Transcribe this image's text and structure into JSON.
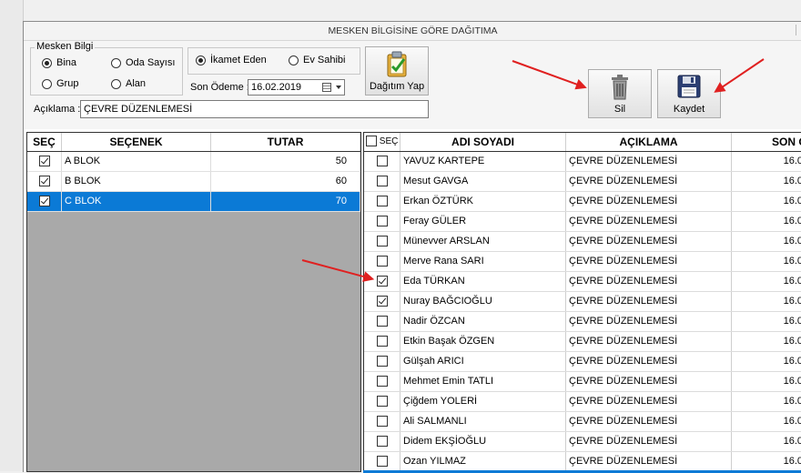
{
  "window": {
    "title": "MESKEN BİLGİSİNE GÖRE DAĞITIMA"
  },
  "mesken_bilgi": {
    "legend": "Mesken Bilgi",
    "options": [
      {
        "label": "Bina",
        "checked": true
      },
      {
        "label": "Oda Sayısı",
        "checked": false
      },
      {
        "label": "Grup",
        "checked": false
      },
      {
        "label": "Alan",
        "checked": false
      }
    ]
  },
  "owner": {
    "options": [
      {
        "label": "İkamet Eden",
        "checked": true
      },
      {
        "label": "Ev Sahibi",
        "checked": false
      }
    ]
  },
  "son_odeme": {
    "label": "Son Ödeme :",
    "value": "16.02.2019"
  },
  "aciklama": {
    "label": "Açıklama :",
    "value": "ÇEVRE DÜZENLEMESİ"
  },
  "buttons": {
    "dagitim": "Dağıtım Yap",
    "sil": "Sil",
    "kaydet": "Kaydet"
  },
  "left_grid": {
    "headers": [
      "SEÇ",
      "SEÇENEK",
      "TUTAR"
    ],
    "rows": [
      {
        "checked": true,
        "secenek": "A BLOK",
        "tutar": "50",
        "selected": false
      },
      {
        "checked": true,
        "secenek": "B BLOK",
        "tutar": "60",
        "selected": false
      },
      {
        "checked": true,
        "secenek": "C BLOK",
        "tutar": "70",
        "selected": true
      }
    ]
  },
  "right_grid": {
    "headers": {
      "sec": "SEÇ",
      "ad": "ADI SOYADI",
      "aciklama": "AÇIKLAMA",
      "son": "SON Ö"
    },
    "rows": [
      {
        "checked": false,
        "ad": "YAVUZ KARTEPE",
        "aciklama": "ÇEVRE DÜZENLEMESİ",
        "son": "16.0"
      },
      {
        "checked": false,
        "ad": "Mesut GAVGA",
        "aciklama": "ÇEVRE DÜZENLEMESİ",
        "son": "16.0"
      },
      {
        "checked": false,
        "ad": "Erkan ÖZTÜRK",
        "aciklama": "ÇEVRE DÜZENLEMESİ",
        "son": "16.0"
      },
      {
        "checked": false,
        "ad": "Feray GÜLER",
        "aciklama": "ÇEVRE DÜZENLEMESİ",
        "son": "16.0"
      },
      {
        "checked": false,
        "ad": "Münevver ARSLAN",
        "aciklama": "ÇEVRE DÜZENLEMESİ",
        "son": "16.0"
      },
      {
        "checked": false,
        "ad": "Merve Rana SARI",
        "aciklama": "ÇEVRE DÜZENLEMESİ",
        "son": "16.0"
      },
      {
        "checked": true,
        "ad": "Eda TÜRKAN",
        "aciklama": "ÇEVRE DÜZENLEMESİ",
        "son": "16.0"
      },
      {
        "checked": true,
        "ad": "Nuray BAĞCIOĞLU",
        "aciklama": "ÇEVRE DÜZENLEMESİ",
        "son": "16.0"
      },
      {
        "checked": false,
        "ad": "Nadir ÖZCAN",
        "aciklama": "ÇEVRE DÜZENLEMESİ",
        "son": "16.0"
      },
      {
        "checked": false,
        "ad": "Etkin Başak ÖZGEN",
        "aciklama": "ÇEVRE DÜZENLEMESİ",
        "son": "16.0"
      },
      {
        "checked": false,
        "ad": "Gülşah ARICI",
        "aciklama": "ÇEVRE DÜZENLEMESİ",
        "son": "16.0"
      },
      {
        "checked": false,
        "ad": "Mehmet Emin TATLI",
        "aciklama": "ÇEVRE DÜZENLEMESİ",
        "son": "16.0"
      },
      {
        "checked": false,
        "ad": "Çiğdem YOLERİ",
        "aciklama": "ÇEVRE DÜZENLEMESİ",
        "son": "16.0"
      },
      {
        "checked": false,
        "ad": "Ali SALMANLI",
        "aciklama": "ÇEVRE DÜZENLEMESİ",
        "son": "16.0"
      },
      {
        "checked": false,
        "ad": "Didem EKŞİOĞLU",
        "aciklama": "ÇEVRE DÜZENLEMESİ",
        "son": "16.0"
      },
      {
        "checked": false,
        "ad": "Ozan YILMAZ",
        "aciklama": "ÇEVRE DÜZENLEMESİ",
        "son": "16.0"
      }
    ]
  },
  "colors": {
    "selection": "#0b7ad6",
    "annotation_arrow": "#e02020"
  }
}
